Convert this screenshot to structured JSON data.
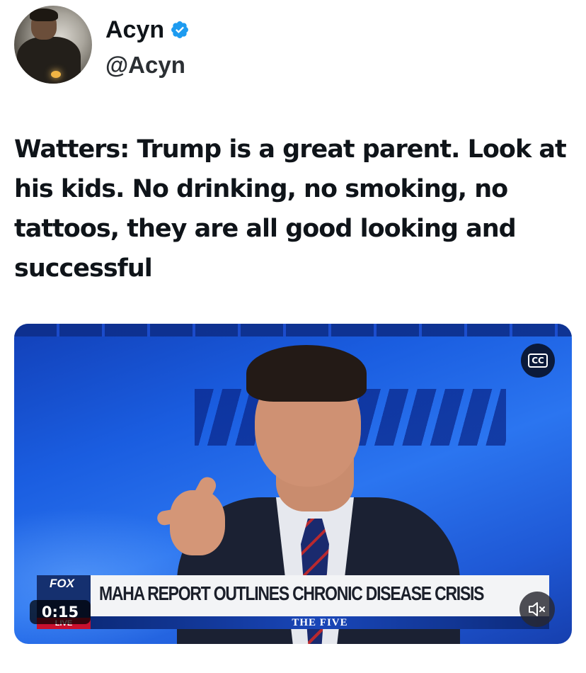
{
  "author": {
    "display_name": "Acyn",
    "handle": "@Acyn",
    "verified": true,
    "verified_badge_color": "#1d9bf0"
  },
  "tweet": {
    "text": "Watters: Trump is a great parent. Look at his kids. No drinking, no smoking, no tattoos, they are all good looking and successful"
  },
  "video": {
    "duration": "0:15",
    "chyron": "MAHA REPORT OUTLINES CHRONIC DISEASE CRISIS",
    "show_name": "THE FIVE",
    "network_logo": "FOX",
    "network_live": "LIVE",
    "captions_label": "CC",
    "captions_icon": "closed-captions-icon",
    "mute_icon": "speaker-muted-icon"
  },
  "colors": {
    "text": "#0f1419",
    "video_bg": "#1a5de0",
    "chyron_bg": "#f3f4f6",
    "fox_blue": "#15306f"
  }
}
